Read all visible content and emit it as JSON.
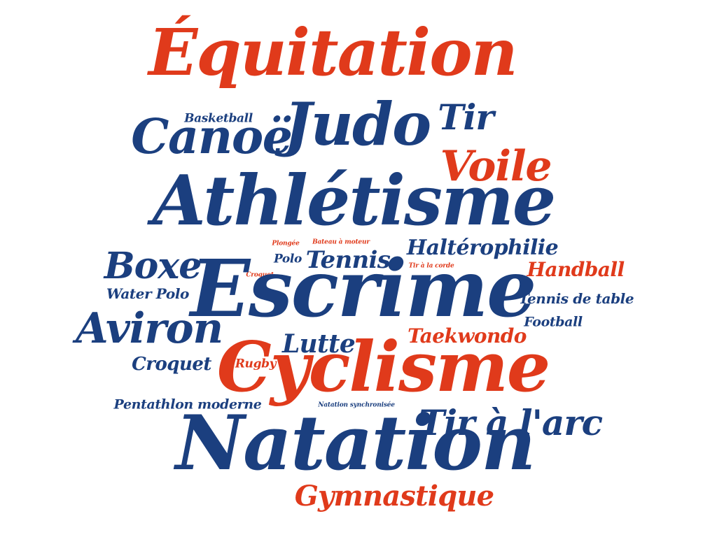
{
  "colors": {
    "blue": "#1b3f7f",
    "red": "#e03a1b",
    "background": "#ffffff"
  },
  "words": [
    {
      "text": "Équitation",
      "color": "red"
    },
    {
      "text": "Judo",
      "color": "blue"
    },
    {
      "text": "Tir",
      "color": "blue"
    },
    {
      "text": "Basketball",
      "color": "blue"
    },
    {
      "text": "Canoë",
      "color": "blue"
    },
    {
      "text": "Voile",
      "color": "red"
    },
    {
      "text": "Athlétisme",
      "color": "blue"
    },
    {
      "text": "Plongée",
      "color": "red"
    },
    {
      "text": "Bateau à moteur",
      "color": "red"
    },
    {
      "text": "Haltérophilie",
      "color": "blue"
    },
    {
      "text": "Boxe",
      "color": "blue"
    },
    {
      "text": "Polo",
      "color": "blue"
    },
    {
      "text": "Tennis",
      "color": "blue"
    },
    {
      "text": "Tir à la corde",
      "color": "red"
    },
    {
      "text": "Handball",
      "color": "red"
    },
    {
      "text": "Croquet",
      "color": "red"
    },
    {
      "text": "Escrime",
      "color": "blue"
    },
    {
      "text": "Water Polo",
      "color": "blue"
    },
    {
      "text": "Tennis de table",
      "color": "blue"
    },
    {
      "text": "Aviron",
      "color": "blue"
    },
    {
      "text": "Football",
      "color": "blue"
    },
    {
      "text": "Lutte",
      "color": "blue"
    },
    {
      "text": "Taekwondo",
      "color": "red"
    },
    {
      "text": "Croquet",
      "color": "blue"
    },
    {
      "text": "Rugby",
      "color": "red"
    },
    {
      "text": "Cyclisme",
      "color": "red"
    },
    {
      "text": "Pentathlon moderne",
      "color": "blue"
    },
    {
      "text": "Natation synchronisée",
      "color": "blue"
    },
    {
      "text": "Tir à l'arc",
      "color": "blue"
    },
    {
      "text": "Natation",
      "color": "blue"
    },
    {
      "text": "Gymnastique",
      "color": "red"
    }
  ]
}
